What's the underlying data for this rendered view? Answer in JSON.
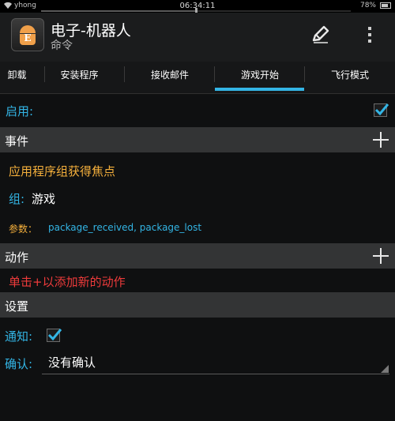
{
  "status_bar": {
    "carrier": "yhong",
    "time": "06:34:11",
    "battery": "78%",
    "battery_level": 0.78,
    "progress": 0.5
  },
  "app": {
    "title": "电子-机器人",
    "subtitle": "命令",
    "icon": "robot-e-icon",
    "icon_letter": "E"
  },
  "tabs": [
    {
      "label": "卸载",
      "active": false
    },
    {
      "label": "安装程序",
      "active": false
    },
    {
      "label": "接收邮件",
      "active": false
    },
    {
      "label": "游戏开始",
      "active": true
    },
    {
      "label": "飞行模式",
      "active": false
    }
  ],
  "enable": {
    "label": "启用:",
    "checked": true
  },
  "event_section": {
    "header": "事件",
    "title": "应用程序组获得焦点",
    "group_label": "组:",
    "group_value": "游戏",
    "params_label": "参数：",
    "params_value": "package_received, package_lost"
  },
  "action_section": {
    "header": "动作",
    "hint": "单击+以添加新的动作"
  },
  "settings_section": {
    "header": "设置",
    "notify_label": "通知:",
    "notify_checked": true,
    "confirm_label": "确认:",
    "confirm_value": "没有确认"
  },
  "colors": {
    "accent": "#33b5e5",
    "event_title": "#f5b03c",
    "action_hint": "#ee3b3b",
    "section_header": "#333435",
    "background": "#0f1011"
  }
}
